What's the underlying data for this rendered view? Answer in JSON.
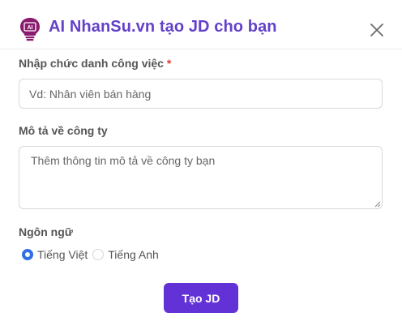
{
  "dialog": {
    "title": "AI NhanSu.vn tạo JD cho bạn",
    "logo_icon": "ai-lightbulb-icon",
    "close_icon": "close-icon",
    "accent_color": "#6441c9"
  },
  "form": {
    "job_title": {
      "label": "Nhập chức danh công việc",
      "required_mark": "*",
      "value": "",
      "placeholder": "Vd: Nhân viên bán hàng"
    },
    "company_description": {
      "label": "Mô tả về công ty",
      "value": "",
      "placeholder": "Thêm thông tin mô tả về công ty bạn"
    },
    "language": {
      "label": "Ngôn ngữ",
      "options": [
        {
          "label": "Tiếng Việt",
          "selected": true
        },
        {
          "label": "Tiếng Anh",
          "selected": false
        }
      ]
    },
    "submit": {
      "label": "Tạo JD",
      "color": "#6332d6"
    }
  }
}
